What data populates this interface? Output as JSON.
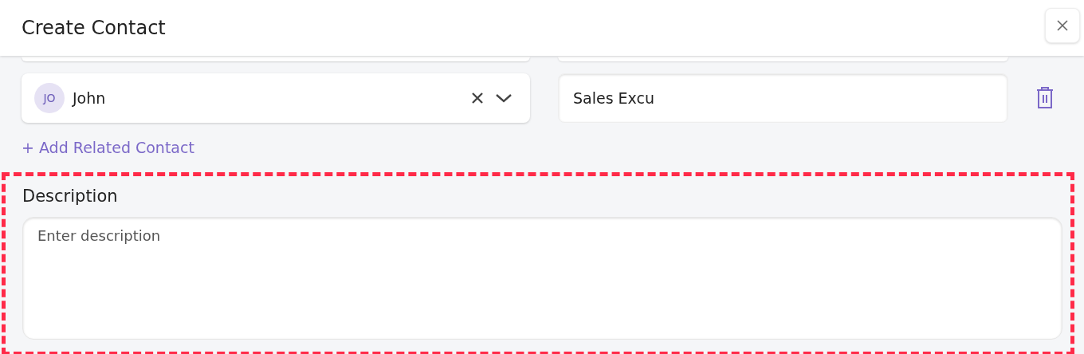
{
  "dialog": {
    "title": "Create Contact"
  },
  "related_contact": {
    "avatar": "JO",
    "name": "John",
    "role": "Sales Excu"
  },
  "add_link": "+ Add Related Contact",
  "description": {
    "label": "Description",
    "placeholder": "Enter description",
    "highlighted": true
  }
}
